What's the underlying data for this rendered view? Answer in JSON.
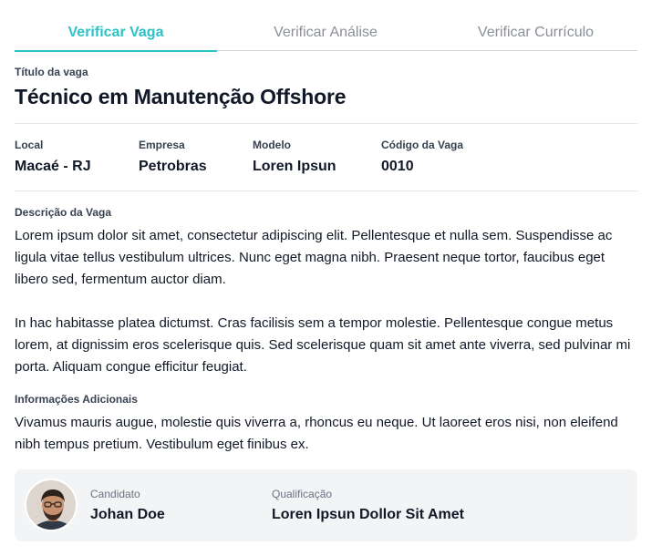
{
  "tabs": [
    {
      "label": "Verificar Vaga",
      "active": true
    },
    {
      "label": "Verificar Análise",
      "active": false
    },
    {
      "label": "Verificar Currículo",
      "active": false
    }
  ],
  "job": {
    "title_label": "Título da vaga",
    "title": "Técnico em Manutenção Offshore"
  },
  "meta": {
    "location_label": "Local",
    "location": "Macaé - RJ",
    "company_label": "Empresa",
    "company": "Petrobras",
    "model_label": "Modelo",
    "model": "Loren Ipsun",
    "code_label": "Código da Vaga",
    "code": "0010"
  },
  "description": {
    "label": "Descrição da Vaga",
    "paragraph1": "Lorem ipsum dolor sit amet, consectetur adipiscing elit. Pellentesque et nulla sem. Suspendisse ac ligula vitae tellus vestibulum ultrices. Nunc eget magna nibh. Praesent neque tortor, faucibus eget libero sed, fermentum auctor diam.",
    "paragraph2": "In hac habitasse platea dictumst. Cras facilisis sem a tempor molestie. Pellentesque congue metus lorem, at dignissim eros scelerisque quis. Sed scelerisque quam sit amet ante viverra, sed pulvinar mi porta. Aliquam congue efficitur feugiat."
  },
  "additional": {
    "label": "Informações Adicionais",
    "text": "Vivamus mauris augue, molestie quis viverra a, rhoncus eu neque. Ut laoreet eros nisi, non eleifend nibh tempus pretium. Vestibulum eget finibus ex."
  },
  "candidate": {
    "name_label": "Candidato",
    "name": "Johan Doe",
    "qualification_label": "Qualificação",
    "qualification": "Loren Ipsun Dollor Sit Amet"
  },
  "colors": {
    "accent": "#2cc3c6",
    "card_bg": "#f3f4f6",
    "text": "#111827"
  }
}
